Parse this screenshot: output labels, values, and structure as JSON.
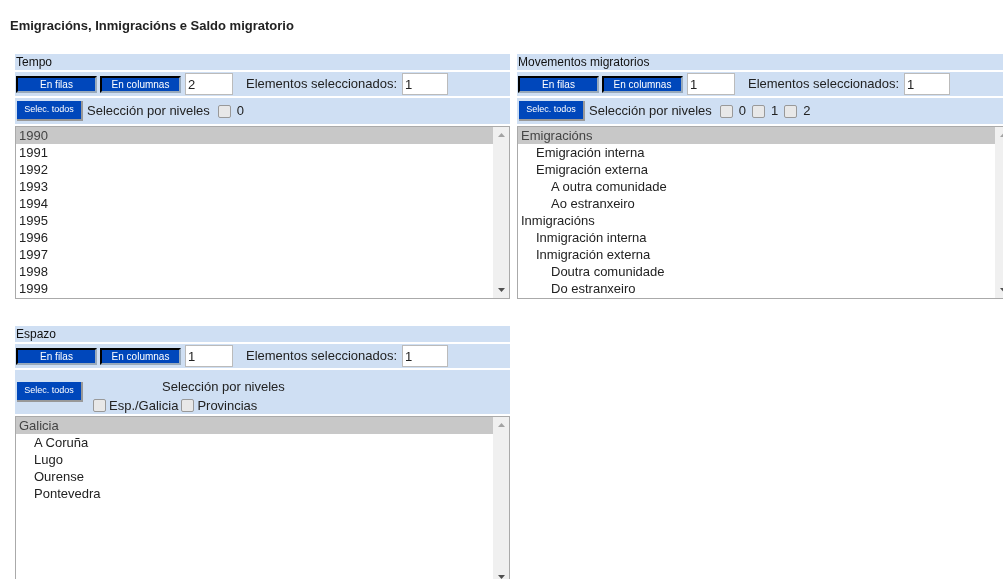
{
  "title": "Emigracións, Inmigracións e Saldo migratorio",
  "panels": [
    {
      "title": "Tempo",
      "kind": "inline",
      "buttons": [
        "En filas",
        "En columnas"
      ],
      "position_value": "2",
      "selected_label": "Elementos seleccionados:",
      "selected_value": "1",
      "select_all": "Selec. todos",
      "levels_label": "Selección por niveles",
      "levels": [
        {
          "label": "0",
          "checked": false
        }
      ],
      "items": [
        {
          "label": "1990",
          "selected": true
        },
        {
          "label": "1991",
          "selected": false
        },
        {
          "label": "1992",
          "selected": false
        },
        {
          "label": "1993",
          "selected": false
        },
        {
          "label": "1994",
          "selected": false
        },
        {
          "label": "1995",
          "selected": false
        },
        {
          "label": "1996",
          "selected": false
        },
        {
          "label": "1997",
          "selected": false
        },
        {
          "label": "1998",
          "selected": false
        },
        {
          "label": "1999",
          "selected": false
        }
      ]
    },
    {
      "title": "Movementos migratorios",
      "kind": "inline",
      "buttons": [
        "En filas",
        "En columnas"
      ],
      "position_value": "1",
      "selected_label": "Elementos seleccionados:",
      "selected_value": "1",
      "select_all": "Selec. todos",
      "levels_label": "Selección por niveles",
      "levels": [
        {
          "label": "0",
          "checked": false
        },
        {
          "label": "1",
          "checked": false
        },
        {
          "label": "2",
          "checked": false
        }
      ],
      "items": [
        {
          "label": "Emigracións",
          "selected": true,
          "children": [
            {
              "label": "Emigración interna",
              "selected": false
            },
            {
              "label": "Emigración externa",
              "selected": false,
              "children": [
                {
                  "label": "A outra comunidade",
                  "selected": false
                },
                {
                  "label": "Ao estranxeiro",
                  "selected": false
                }
              ]
            }
          ]
        },
        {
          "label": "Inmigracións",
          "selected": false,
          "children": [
            {
              "label": "Inmigración interna",
              "selected": false
            },
            {
              "label": "Inmigración externa",
              "selected": false,
              "children": [
                {
                  "label": "Doutra comunidade",
                  "selected": false
                },
                {
                  "label": "Do estranxeiro",
                  "selected": false
                }
              ]
            }
          ]
        }
      ]
    },
    {
      "title": "Espazo",
      "kind": "stacked",
      "buttons": [
        "En filas",
        "En columnas"
      ],
      "position_value": "1",
      "selected_label": "Elementos seleccionados:",
      "selected_value": "1",
      "select_all": "Selec. todos",
      "levels_label": "Selección por niveles",
      "levels": [
        {
          "label": "Esp./Galicia",
          "checked": false
        },
        {
          "label": "Provincias",
          "checked": false
        }
      ],
      "items": [
        {
          "label": "Galicia",
          "selected": true,
          "children": [
            {
              "label": "A Coruña",
              "selected": false
            },
            {
              "label": "Lugo",
              "selected": false
            },
            {
              "label": "Ourense",
              "selected": false
            },
            {
              "label": "Pontevedra",
              "selected": false
            }
          ]
        }
      ]
    }
  ]
}
